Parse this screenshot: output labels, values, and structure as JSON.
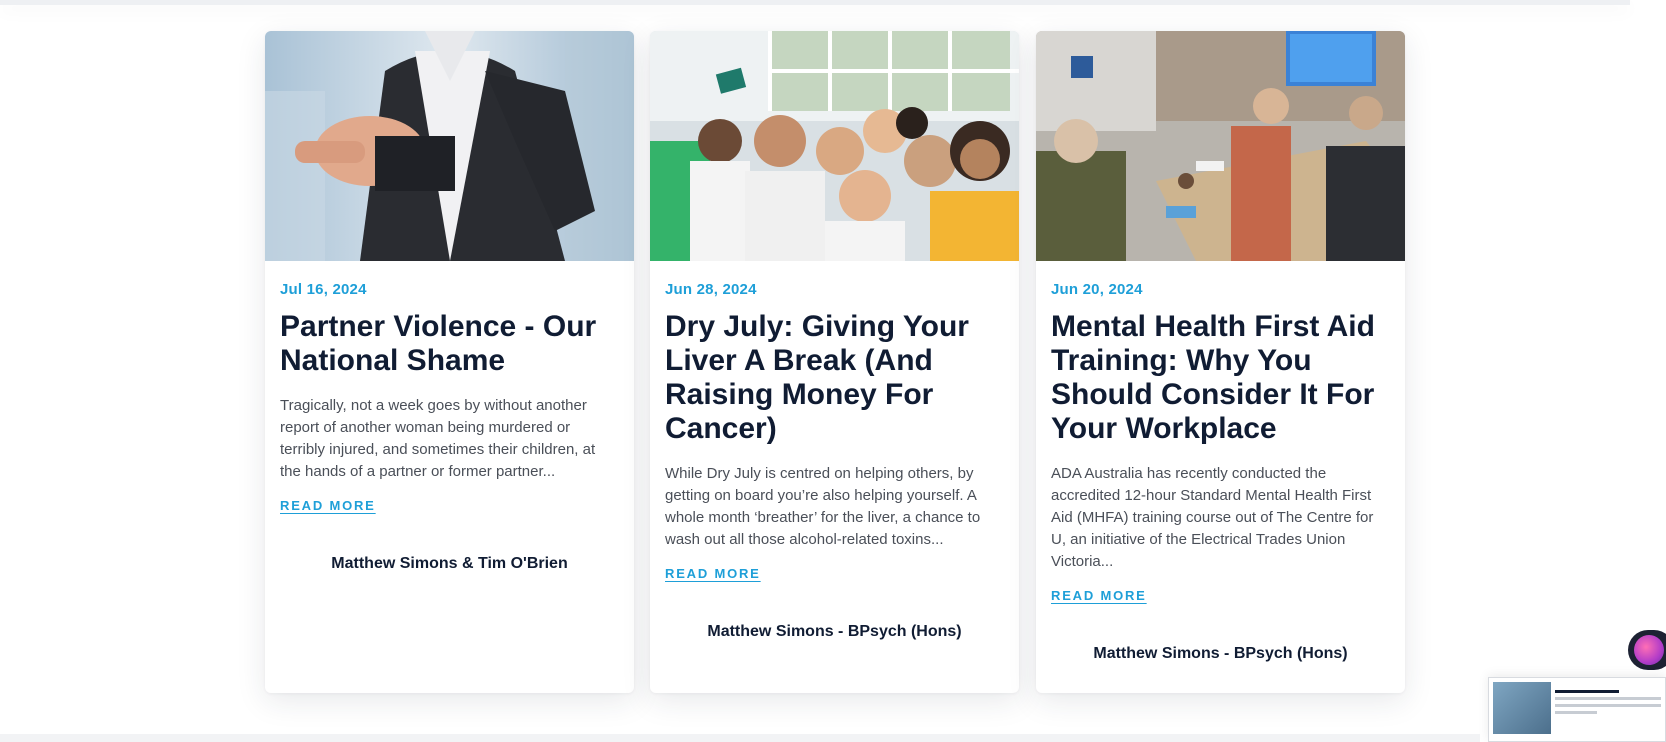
{
  "cards": [
    {
      "image_icon": "man-pointing-photo",
      "date": "Jul 16, 2024",
      "title": "Partner Violence - Our National Shame",
      "excerpt": "Tragically, not a week goes by without another report of another woman being murdered or terribly injured, and sometimes their children, at the hands of a partner or former partner...",
      "read_more": "READ MORE",
      "author": "Matthew Simons & Tim O'Brien"
    },
    {
      "image_icon": "group-selfie-photo",
      "date": "Jun 28, 2024",
      "title": "Dry July: Giving Your Liver A Break (And Raising Money For Cancer)",
      "excerpt": "While Dry July is centred on helping others, by getting on board you’re also helping yourself. A whole month ‘breather’ for the liver, a chance to wash out all those alcohol-related toxins...",
      "read_more": "READ MORE",
      "author": "Matthew Simons - BPsych (Hons)"
    },
    {
      "image_icon": "training-room-photo",
      "date": "Jun 20, 2024",
      "title": "Mental Health First Aid Training: Why You Should Consider It For Your Workplace",
      "excerpt": "ADA Australia has recently conducted the accredited 12-hour Standard Mental Health First Aid (MHFA) training course out of The Centre for U, an initiative of the Electrical Trades Union Victoria...",
      "read_more": "READ MORE",
      "author": "Matthew Simons - BPsych (Hons)"
    }
  ],
  "colors": {
    "accent": "#1e9fd8",
    "title": "#101c33",
    "body": "#4a4f58"
  }
}
